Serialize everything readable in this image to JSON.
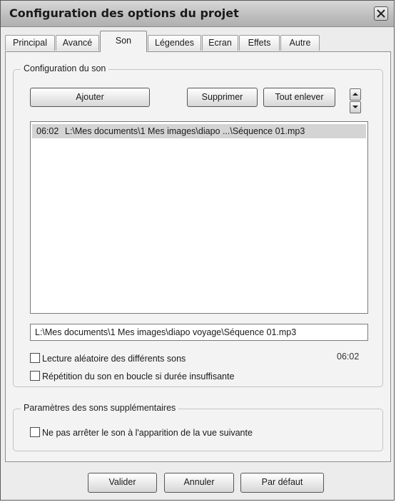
{
  "window": {
    "title": "Configuration des options du projet"
  },
  "tabs": [
    {
      "label": "Principal"
    },
    {
      "label": "Avancé"
    },
    {
      "label": "Son"
    },
    {
      "label": "Légendes"
    },
    {
      "label": "Ecran"
    },
    {
      "label": "Effets"
    },
    {
      "label": "Autre"
    }
  ],
  "active_tab": "Son",
  "sound_group": {
    "label": "Configuration du son",
    "add_button": "Ajouter",
    "delete_button": "Supprimer",
    "remove_all_button": "Tout enlever",
    "list": [
      {
        "time": "06:02",
        "path": "L:\\Mes documents\\1 Mes images\\diapo ...\\Séquence 01.mp3",
        "selected": true
      }
    ],
    "selected_path": "L:\\Mes documents\\1 Mes images\\diapo voyage\\Séquence 01.mp3",
    "random_checkbox": {
      "label": "Lecture aléatoire des différents sons",
      "checked": false
    },
    "loop_checkbox": {
      "label": "Répétition du son en boucle si durée insuffisante",
      "checked": false
    },
    "total_duration": "06:02"
  },
  "extra_group": {
    "label": "Paramètres des sons supplémentaires",
    "nostop_checkbox": {
      "label": "Ne pas arrêter le son à l'apparition de la vue suivante",
      "checked": false
    }
  },
  "footer": {
    "ok_button": "Valider",
    "cancel_button": "Annuler",
    "default_button": "Par défaut"
  },
  "icons": {
    "close": "close-icon",
    "up": "chevron-up-icon",
    "down": "chevron-down-icon"
  }
}
